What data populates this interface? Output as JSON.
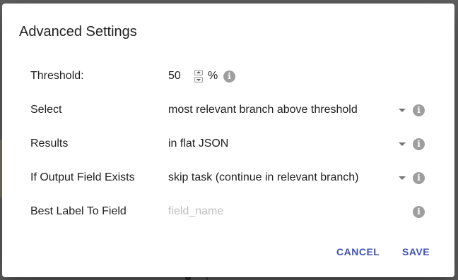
{
  "dialog": {
    "title": "Advanced Settings",
    "threshold": {
      "label": "Threshold:",
      "value": "50",
      "unit": "%",
      "info_icon": "info-icon"
    },
    "select": {
      "label": "Select",
      "value": "most relevant branch above threshold",
      "info_icon": "info-icon"
    },
    "results": {
      "label": "Results",
      "value": "in flat JSON",
      "info_icon": "info-icon"
    },
    "output_field_exists": {
      "label": "If Output Field Exists",
      "value": "skip task (continue in relevant branch)",
      "info_icon": "info-icon"
    },
    "best_label_to_field": {
      "label": "Best Label To Field",
      "placeholder": "field_name",
      "value": "",
      "info_icon": "info-icon"
    },
    "actions": {
      "cancel_label": "CANCEL",
      "save_label": "SAVE"
    }
  },
  "colors": {
    "accent": "#3f51b5",
    "backdrop": "#5f5f5f",
    "icon_gray": "#9e9e9e",
    "placeholder": "#bdbdbd"
  }
}
